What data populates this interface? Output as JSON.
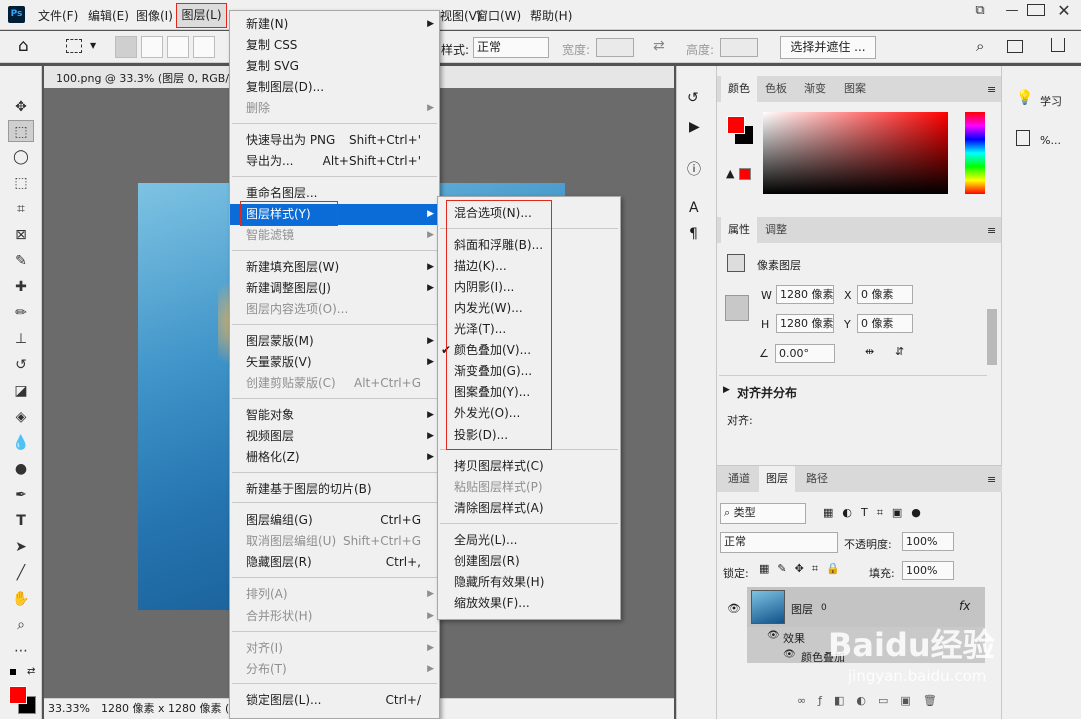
{
  "app": {
    "logo": "Ps"
  },
  "menubar": [
    "文件(F)",
    "编辑(E)",
    "图像(I)",
    "图层(L)",
    "视图(V)",
    "窗口(W)",
    "帮助(H)"
  ],
  "window_buttons": [
    "restore-icon",
    "minimize-icon",
    "maximize-icon",
    "close-icon"
  ],
  "options": {
    "style_label": "样式:",
    "style_value": "正常",
    "width_label": "宽度:",
    "height_label": "高度:",
    "select_mask": "选择并遮住 ..."
  },
  "doc_tab": "100.png @ 33.3% (图层 0, RGB/8",
  "status": {
    "zoom": "33.33%",
    "info": "1280 像素 x 1280 像素 (7"
  },
  "layer_menu": [
    {
      "label": "新建(N)",
      "arrow": true
    },
    {
      "label": "复制 CSS"
    },
    {
      "label": "复制 SVG"
    },
    {
      "label": "复制图层(D)..."
    },
    {
      "label": "删除",
      "arrow": true,
      "disabled": true
    },
    {
      "label": "快速导出为 PNG",
      "shortcut": "Shift+Ctrl+'"
    },
    {
      "label": "导出为...",
      "shortcut": "Alt+Shift+Ctrl+'"
    },
    {
      "label": "重命名图层..."
    },
    {
      "label": "图层样式(Y)",
      "arrow": true,
      "highlight": true
    },
    {
      "label": "智能滤镜",
      "arrow": true,
      "disabled": true
    },
    {
      "label": "新建填充图层(W)",
      "arrow": true
    },
    {
      "label": "新建调整图层(J)",
      "arrow": true
    },
    {
      "label": "图层内容选项(O)...",
      "disabled": true
    },
    {
      "label": "图层蒙版(M)",
      "arrow": true
    },
    {
      "label": "矢量蒙版(V)",
      "arrow": true
    },
    {
      "label": "创建剪贴蒙版(C)",
      "shortcut": "Alt+Ctrl+G",
      "disabled": true
    },
    {
      "label": "智能对象",
      "arrow": true
    },
    {
      "label": "视频图层",
      "arrow": true
    },
    {
      "label": "栅格化(Z)",
      "arrow": true
    },
    {
      "label": "新建基于图层的切片(B)"
    },
    {
      "label": "图层编组(G)",
      "shortcut": "Ctrl+G"
    },
    {
      "label": "取消图层编组(U)",
      "shortcut": "Shift+Ctrl+G",
      "disabled": true
    },
    {
      "label": "隐藏图层(R)",
      "shortcut": "Ctrl+,"
    },
    {
      "label": "排列(A)",
      "arrow": true,
      "disabled": true
    },
    {
      "label": "合并形状(H)",
      "arrow": true,
      "disabled": true
    },
    {
      "label": "对齐(I)",
      "arrow": true,
      "disabled": true
    },
    {
      "label": "分布(T)",
      "arrow": true,
      "disabled": true
    },
    {
      "label": "锁定图层(L)...",
      "shortcut": "Ctrl+/"
    }
  ],
  "style_menu": [
    {
      "label": "混合选项(N)..."
    },
    {
      "label": "斜面和浮雕(B)..."
    },
    {
      "label": "描边(K)..."
    },
    {
      "label": "内阴影(I)..."
    },
    {
      "label": "内发光(W)..."
    },
    {
      "label": "光泽(T)..."
    },
    {
      "label": "颜色叠加(V)...",
      "checked": true
    },
    {
      "label": "渐变叠加(G)..."
    },
    {
      "label": "图案叠加(Y)..."
    },
    {
      "label": "外发光(O)..."
    },
    {
      "label": "投影(D)..."
    },
    {
      "label": "拷贝图层样式(C)"
    },
    {
      "label": "粘贴图层样式(P)",
      "disabled": true
    },
    {
      "label": "清除图层样式(A)"
    },
    {
      "label": "全局光(L)..."
    },
    {
      "label": "创建图层(R)"
    },
    {
      "label": "隐藏所有效果(H)"
    },
    {
      "label": "缩放效果(F)..."
    }
  ],
  "color_panel": {
    "tabs": [
      "颜色",
      "色板",
      "渐变",
      "图案"
    ],
    "fg": "#ff0000",
    "bg": "#000000"
  },
  "props_panel": {
    "tabs": [
      "属性",
      "调整"
    ],
    "title": "像素图层",
    "w_label": "W",
    "w": "1280 像素",
    "x_label": "X",
    "x": "0 像素",
    "h_label": "H",
    "h": "1280 像素",
    "y_label": "Y",
    "y": "0 像素",
    "angle": "0.00°",
    "align_title": "对齐并分布",
    "align_label": "对齐:"
  },
  "learn": {
    "learn": "学习",
    "pct": "%..."
  },
  "layers_panel": {
    "tabs": [
      "通道",
      "图层",
      "路径"
    ],
    "filter": "类型",
    "blend": "正常",
    "opacity_label": "不透明度:",
    "opacity": "100%",
    "lock_label": "锁定:",
    "fill_label": "填充:",
    "fill": "100%",
    "layer_name": "图层",
    "layer_num": "0",
    "fx": "fx",
    "effects": "效果",
    "effect_item": "颜色叠加"
  },
  "watermark": {
    "text": "Baidu经验",
    "url": "jingyan.baidu.com"
  }
}
